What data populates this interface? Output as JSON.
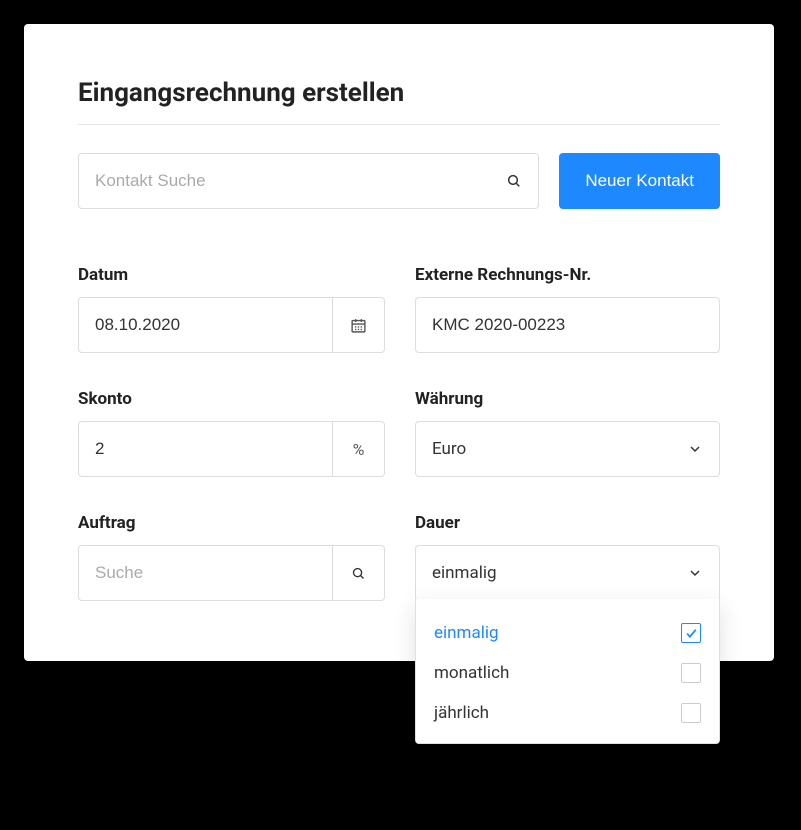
{
  "pageTitle": "Eingangsrechnung erstellen",
  "contactSearch": {
    "placeholder": "Kontakt Suche"
  },
  "newContactButton": "Neuer Kontakt",
  "fields": {
    "datum": {
      "label": "Datum",
      "value": "08.10.2020"
    },
    "externeNr": {
      "label": "Externe Rechnungs-Nr.",
      "value": "KMC 2020-00223"
    },
    "skonto": {
      "label": "Skonto",
      "value": "2",
      "unit": "%"
    },
    "waehrung": {
      "label": "Währung",
      "value": "Euro"
    },
    "auftrag": {
      "label": "Auftrag",
      "placeholder": "Suche"
    },
    "dauer": {
      "label": "Dauer",
      "value": "einmalig",
      "options": [
        {
          "label": "einmalig",
          "selected": true
        },
        {
          "label": "monatlich",
          "selected": false
        },
        {
          "label": "jährlich",
          "selected": false
        }
      ]
    }
  }
}
